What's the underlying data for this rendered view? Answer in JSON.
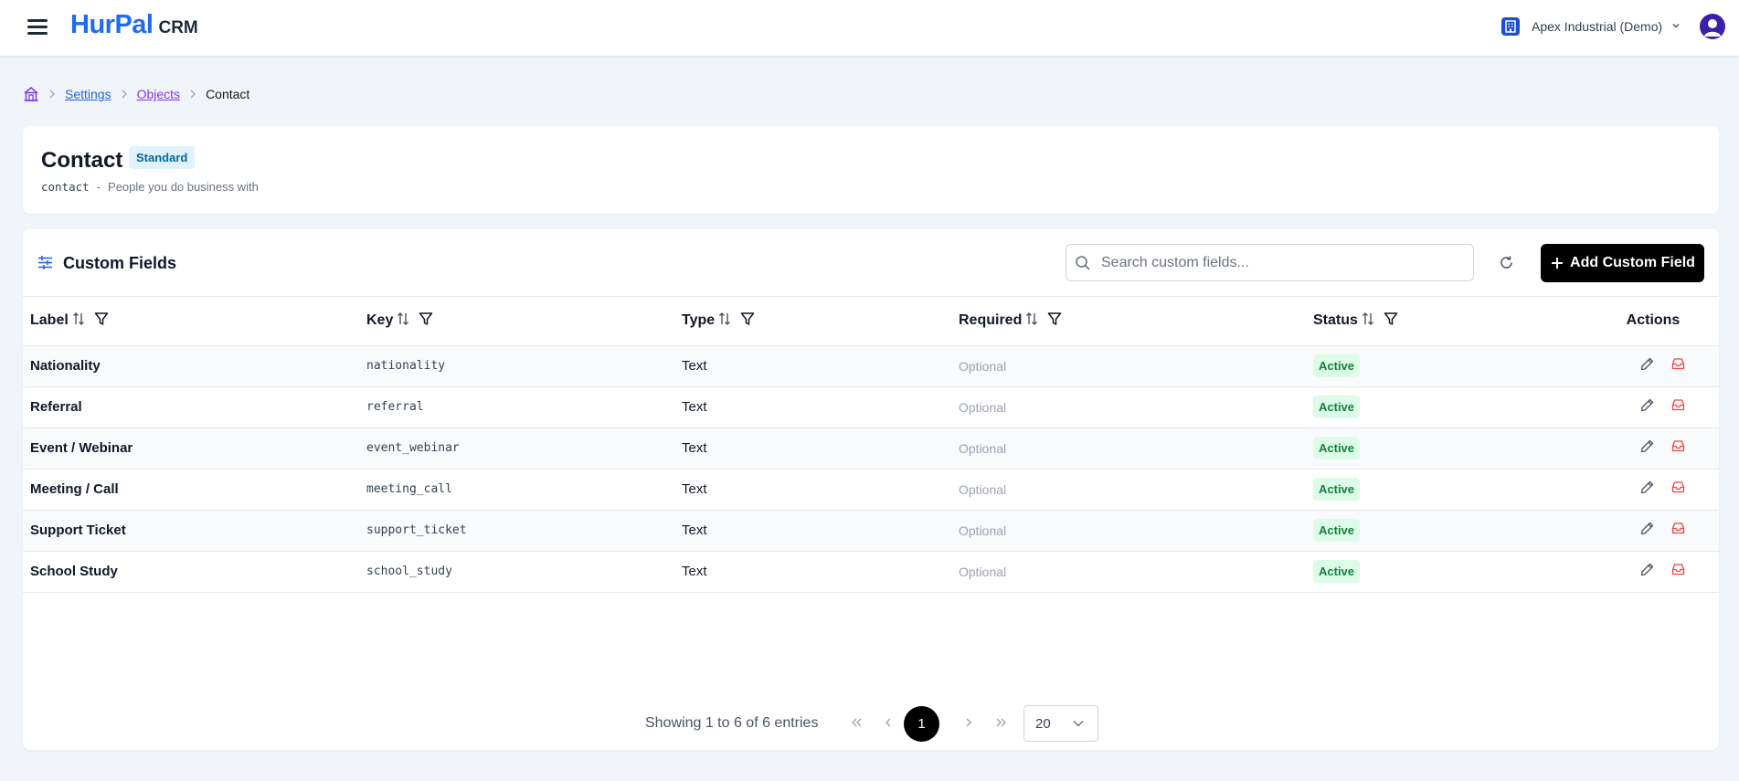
{
  "header": {
    "logo_main": "HurPal",
    "logo_sub": "CRM",
    "org_name": "Apex Industrial (Demo)"
  },
  "breadcrumb": {
    "items": [
      "Settings",
      "Objects"
    ],
    "current": "Contact"
  },
  "object": {
    "title": "Contact",
    "badge": "Standard",
    "key": "contact",
    "separator": "-",
    "description": "People you do business with"
  },
  "custom_fields": {
    "title": "Custom Fields",
    "search_placeholder": "Search custom fields...",
    "add_label": "Add Custom Field",
    "columns": {
      "label": "Label",
      "key": "Key",
      "type": "Type",
      "required": "Required",
      "status": "Status",
      "actions": "Actions"
    },
    "rows": [
      {
        "label": "Nationality",
        "key": "nationality",
        "type": "Text",
        "required": "Optional",
        "status": "Active"
      },
      {
        "label": "Referral",
        "key": "referral",
        "type": "Text",
        "required": "Optional",
        "status": "Active"
      },
      {
        "label": "Event / Webinar",
        "key": "event_webinar",
        "type": "Text",
        "required": "Optional",
        "status": "Active"
      },
      {
        "label": "Meeting / Call",
        "key": "meeting_call",
        "type": "Text",
        "required": "Optional",
        "status": "Active"
      },
      {
        "label": "Support Ticket",
        "key": "support_ticket",
        "type": "Text",
        "required": "Optional",
        "status": "Active"
      },
      {
        "label": "School Study",
        "key": "school_study",
        "type": "Text",
        "required": "Optional",
        "status": "Active"
      }
    ]
  },
  "pagination": {
    "info": "Showing 1 to 6 of 6 entries",
    "current_page": "1",
    "page_size": "20"
  },
  "colors": {
    "brand": "#1d6bf3",
    "active_badge_bg": "#dcfce7",
    "active_badge_text": "#15803d",
    "delete_icon": "#ef4444"
  },
  "icons": [
    "menu-icon",
    "building-icon",
    "chevron-down-icon",
    "user-avatar-icon",
    "home-icon",
    "chevron-right-icon",
    "sliders-icon",
    "search-icon",
    "refresh-icon",
    "plus-icon",
    "sort-icon",
    "filter-icon",
    "edit-icon",
    "archive-icon",
    "double-chevron-left-icon",
    "chevron-left-icon",
    "double-chevron-right-icon"
  ]
}
